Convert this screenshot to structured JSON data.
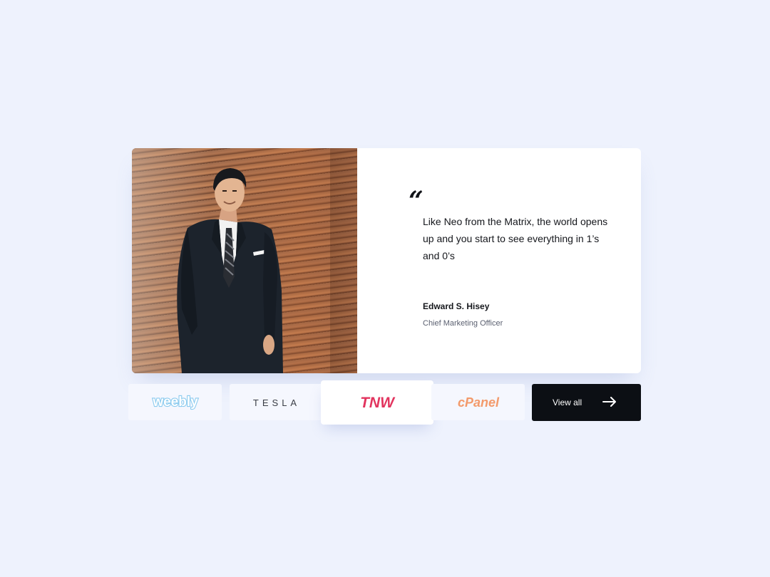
{
  "testimonial": {
    "quote_mark": "“",
    "quote": "Like Neo from the Matrix, the world opens up and you start to see everything in 1’s and 0’s",
    "author_name": "Edward S. Hisey",
    "author_title": "Chief Marketing Officer"
  },
  "logos": [
    {
      "text": "weebly",
      "color": "#8ccbef"
    },
    {
      "text": "TESLA",
      "color": "#3a3d45"
    },
    {
      "text": "TNW",
      "color": "#e2345e",
      "selected": true
    },
    {
      "text": "cPanel",
      "color": "#f39a6b"
    }
  ],
  "view_all": {
    "label": "View all",
    "icon": "arrow-right-icon"
  },
  "colors": {
    "background": "#eef2fd",
    "button_bg": "#0c0f14",
    "tile_bg": "#f5f7fe"
  }
}
